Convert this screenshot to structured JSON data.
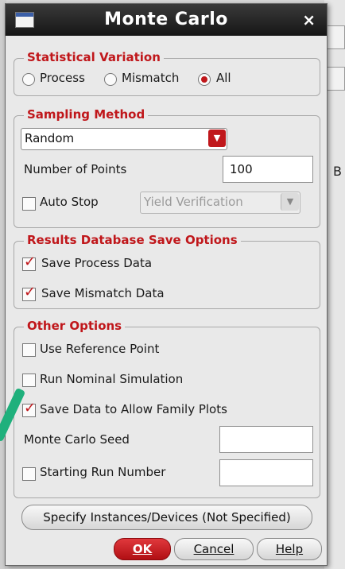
{
  "window": {
    "title": "Monte Carlo",
    "close_glyph": "×"
  },
  "statistical_variation": {
    "title": "Statistical Variation",
    "options": [
      "Process",
      "Mismatch",
      "All"
    ],
    "selected": "All"
  },
  "sampling_method": {
    "title": "Sampling Method",
    "method_value": "Random",
    "points_label": "Number of Points",
    "points_value": "100",
    "auto_stop_label": "Auto Stop",
    "auto_stop_checked": false,
    "auto_stop_combo": "Yield Verification"
  },
  "results_db": {
    "title": "Results Database Save Options",
    "save_process_label": "Save Process Data",
    "save_process_checked": true,
    "save_mismatch_label": "Save Mismatch Data",
    "save_mismatch_checked": true
  },
  "other_options": {
    "title": "Other Options",
    "use_ref_label": "Use Reference Point",
    "use_ref_checked": false,
    "run_nominal_label": "Run Nominal Simulation",
    "run_nominal_checked": false,
    "family_plots_label": "Save Data to Allow Family Plots",
    "family_plots_checked": true,
    "seed_label": "Monte Carlo Seed",
    "seed_value": "",
    "start_run_label": "Starting Run Number",
    "start_run_checked": false,
    "start_run_value": ""
  },
  "buttons": {
    "specify_label": "Specify Instances/Devices (Not Specified)",
    "ok_label": "OK",
    "cancel_label": "Cancel",
    "help_label": "Help"
  },
  "colors": {
    "accent": "#c0171b",
    "titlebar": "#1f1f1f",
    "annotation": "#1fb07c"
  },
  "background": {
    "right_glyph": "B"
  }
}
